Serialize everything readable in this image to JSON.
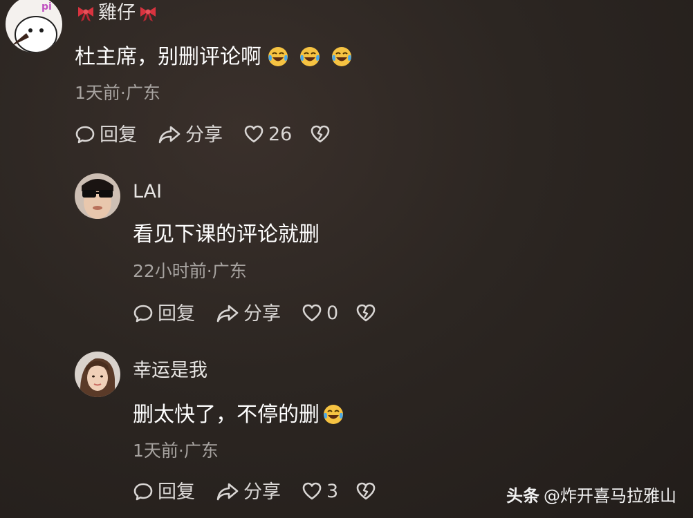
{
  "comments": [
    {
      "username": "雞仔",
      "avatar_text": "pi",
      "content": "杜主席，别删评论啊",
      "emoji_count": 3,
      "time": "1天前",
      "location": "广东",
      "meta": "1天前·广东",
      "reply_label": "回复",
      "share_label": "分享",
      "likes": "26"
    },
    {
      "username": "LAI",
      "content": "看见下课的评论就删",
      "emoji_count": 0,
      "time": "22小时前",
      "location": "广东",
      "meta": "22小时前·广东",
      "reply_label": "回复",
      "share_label": "分享",
      "likes": "0"
    },
    {
      "username": "幸运是我",
      "content": "删太快了，不停的删",
      "emoji_count": 1,
      "time": "1天前",
      "location": "广东",
      "meta": "1天前·广东",
      "reply_label": "回复",
      "share_label": "分享",
      "likes": "3"
    }
  ],
  "watermark": {
    "brand": "头条",
    "handle": "@炸开喜马拉雅山"
  },
  "colors": {
    "background": "#2a2421",
    "text": "#ffffff",
    "meta_text": "#a7a3a0",
    "ribbon": "#d8333f",
    "emoji": "#f6c342"
  },
  "icons": [
    "ribbon-icon",
    "laughing-crying-emoji",
    "reply-bubble-icon",
    "share-arrow-icon",
    "heart-icon",
    "broken-heart-icon"
  ]
}
